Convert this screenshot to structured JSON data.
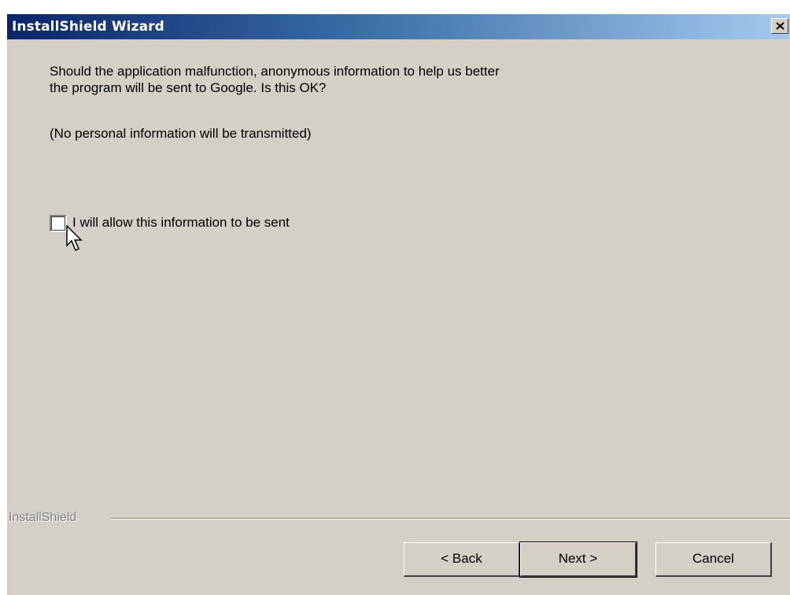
{
  "window": {
    "title": "InstallShield Wizard",
    "close_glyph": "✕"
  },
  "content": {
    "message_line1": "Should the application malfunction, anonymous information to help us better",
    "message_line2": "the program will be sent to Google. Is this OK?",
    "note": "(No personal information will be transmitted)",
    "checkbox": {
      "label": "I will allow this information to be sent",
      "checked": false
    }
  },
  "footer": {
    "brand": "InstallShield",
    "back_label": "< Back",
    "next_label": "Next >",
    "cancel_label": "Cancel"
  },
  "icons": {
    "close": "close-icon",
    "cursor": "mouse-pointer-icon"
  },
  "colors": {
    "title_gradient_start": "#0a246a",
    "title_gradient_end": "#a6caf0",
    "dialog_face": "#d4d0c8"
  }
}
